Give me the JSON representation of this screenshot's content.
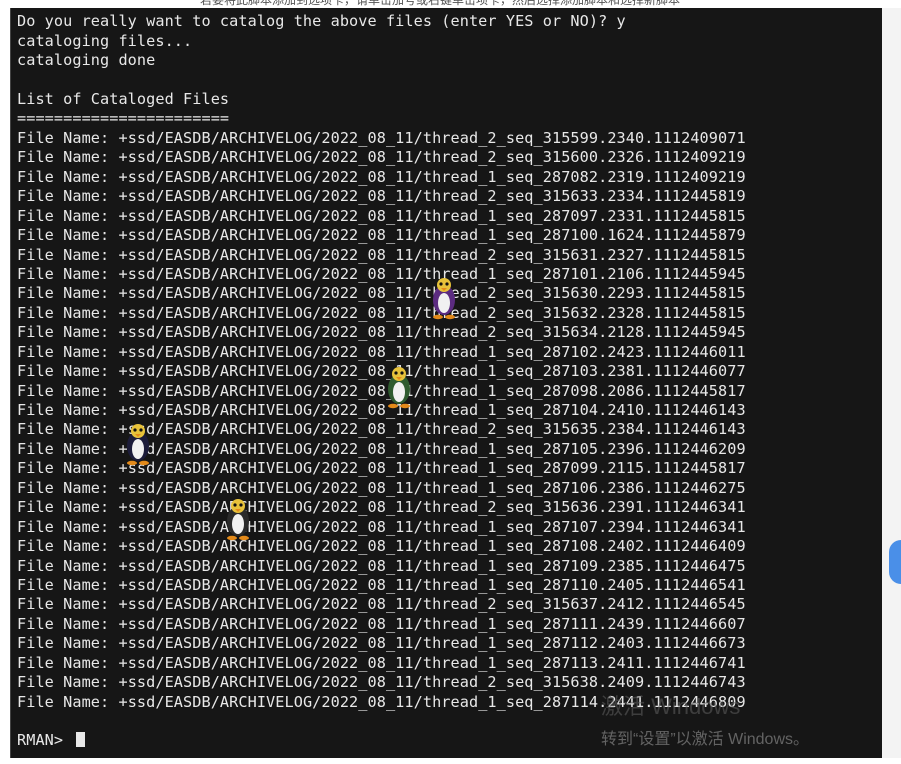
{
  "top_strip_text": "若要将此脚本添加到选项卡，请单击加号或右键单击项卡，然后选择添加脚本和选择新脚本",
  "prompt_line": "Do you really want to catalog the above files (enter YES or NO)? y",
  "status_lines": [
    "cataloging files...",
    "cataloging done"
  ],
  "list_title": "List of Cataloged Files",
  "list_underline": "=======================",
  "file_prefix": "File Name: ",
  "files": [
    "+ssd/EASDB/ARCHIVELOG/2022_08_11/thread_2_seq_315599.2340.1112409071",
    "+ssd/EASDB/ARCHIVELOG/2022_08_11/thread_2_seq_315600.2326.1112409219",
    "+ssd/EASDB/ARCHIVELOG/2022_08_11/thread_1_seq_287082.2319.1112409219",
    "+ssd/EASDB/ARCHIVELOG/2022_08_11/thread_2_seq_315633.2334.1112445819",
    "+ssd/EASDB/ARCHIVELOG/2022_08_11/thread_1_seq_287097.2331.1112445815",
    "+ssd/EASDB/ARCHIVELOG/2022_08_11/thread_1_seq_287100.1624.1112445879",
    "+ssd/EASDB/ARCHIVELOG/2022_08_11/thread_2_seq_315631.2327.1112445815",
    "+ssd/EASDB/ARCHIVELOG/2022_08_11/thread_1_seq_287101.2106.1112445945",
    "+ssd/EASDB/ARCHIVELOG/2022_08_11/thread_2_seq_315630.2293.1112445815",
    "+ssd/EASDB/ARCHIVELOG/2022_08_11/thread_2_seq_315632.2328.1112445815",
    "+ssd/EASDB/ARCHIVELOG/2022_08_11/thread_2_seq_315634.2128.1112445945",
    "+ssd/EASDB/ARCHIVELOG/2022_08_11/thread_1_seq_287102.2423.1112446011",
    "+ssd/EASDB/ARCHIVELOG/2022_08_11/thread_1_seq_287103.2381.1112446077",
    "+ssd/EASDB/ARCHIVELOG/2022_08_11/thread_1_seq_287098.2086.1112445817",
    "+ssd/EASDB/ARCHIVELOG/2022_08_11/thread_1_seq_287104.2410.1112446143",
    "+ssd/EASDB/ARCHIVELOG/2022_08_11/thread_2_seq_315635.2384.1112446143",
    "+ssd/EASDB/ARCHIVELOG/2022_08_11/thread_1_seq_287105.2396.1112446209",
    "+ssd/EASDB/ARCHIVELOG/2022_08_11/thread_1_seq_287099.2115.1112445817",
    "+ssd/EASDB/ARCHIVELOG/2022_08_11/thread_1_seq_287106.2386.1112446275",
    "+ssd/EASDB/ARCHIVELOG/2022_08_11/thread_2_seq_315636.2391.1112446341",
    "+ssd/EASDB/ARCHIVELOG/2022_08_11/thread_1_seq_287107.2394.1112446341",
    "+ssd/EASDB/ARCHIVELOG/2022_08_11/thread_1_seq_287108.2402.1112446409",
    "+ssd/EASDB/ARCHIVELOG/2022_08_11/thread_1_seq_287109.2385.1112446475",
    "+ssd/EASDB/ARCHIVELOG/2022_08_11/thread_1_seq_287110.2405.1112446541",
    "+ssd/EASDB/ARCHIVELOG/2022_08_11/thread_2_seq_315637.2412.1112446545",
    "+ssd/EASDB/ARCHIVELOG/2022_08_11/thread_1_seq_287111.2439.1112446607",
    "+ssd/EASDB/ARCHIVELOG/2022_08_11/thread_1_seq_287112.2403.1112446673",
    "+ssd/EASDB/ARCHIVELOG/2022_08_11/thread_1_seq_287113.2411.1112446741",
    "+ssd/EASDB/ARCHIVELOG/2022_08_11/thread_2_seq_315638.2409.1112446743",
    "+ssd/EASDB/ARCHIVELOG/2022_08_11/thread_1_seq_287114.2441.1112446809"
  ],
  "rman_prompt": "RMAN> ",
  "watermark": {
    "title": "激活 Windows",
    "subtitle": "转到“设置”以激活 Windows。"
  },
  "colors": {
    "terminal_bg": "#161616",
    "terminal_text": "#e8e8e8",
    "accent_blue": "#4a8fe8"
  },
  "icons": [
    "penguin-icon"
  ]
}
